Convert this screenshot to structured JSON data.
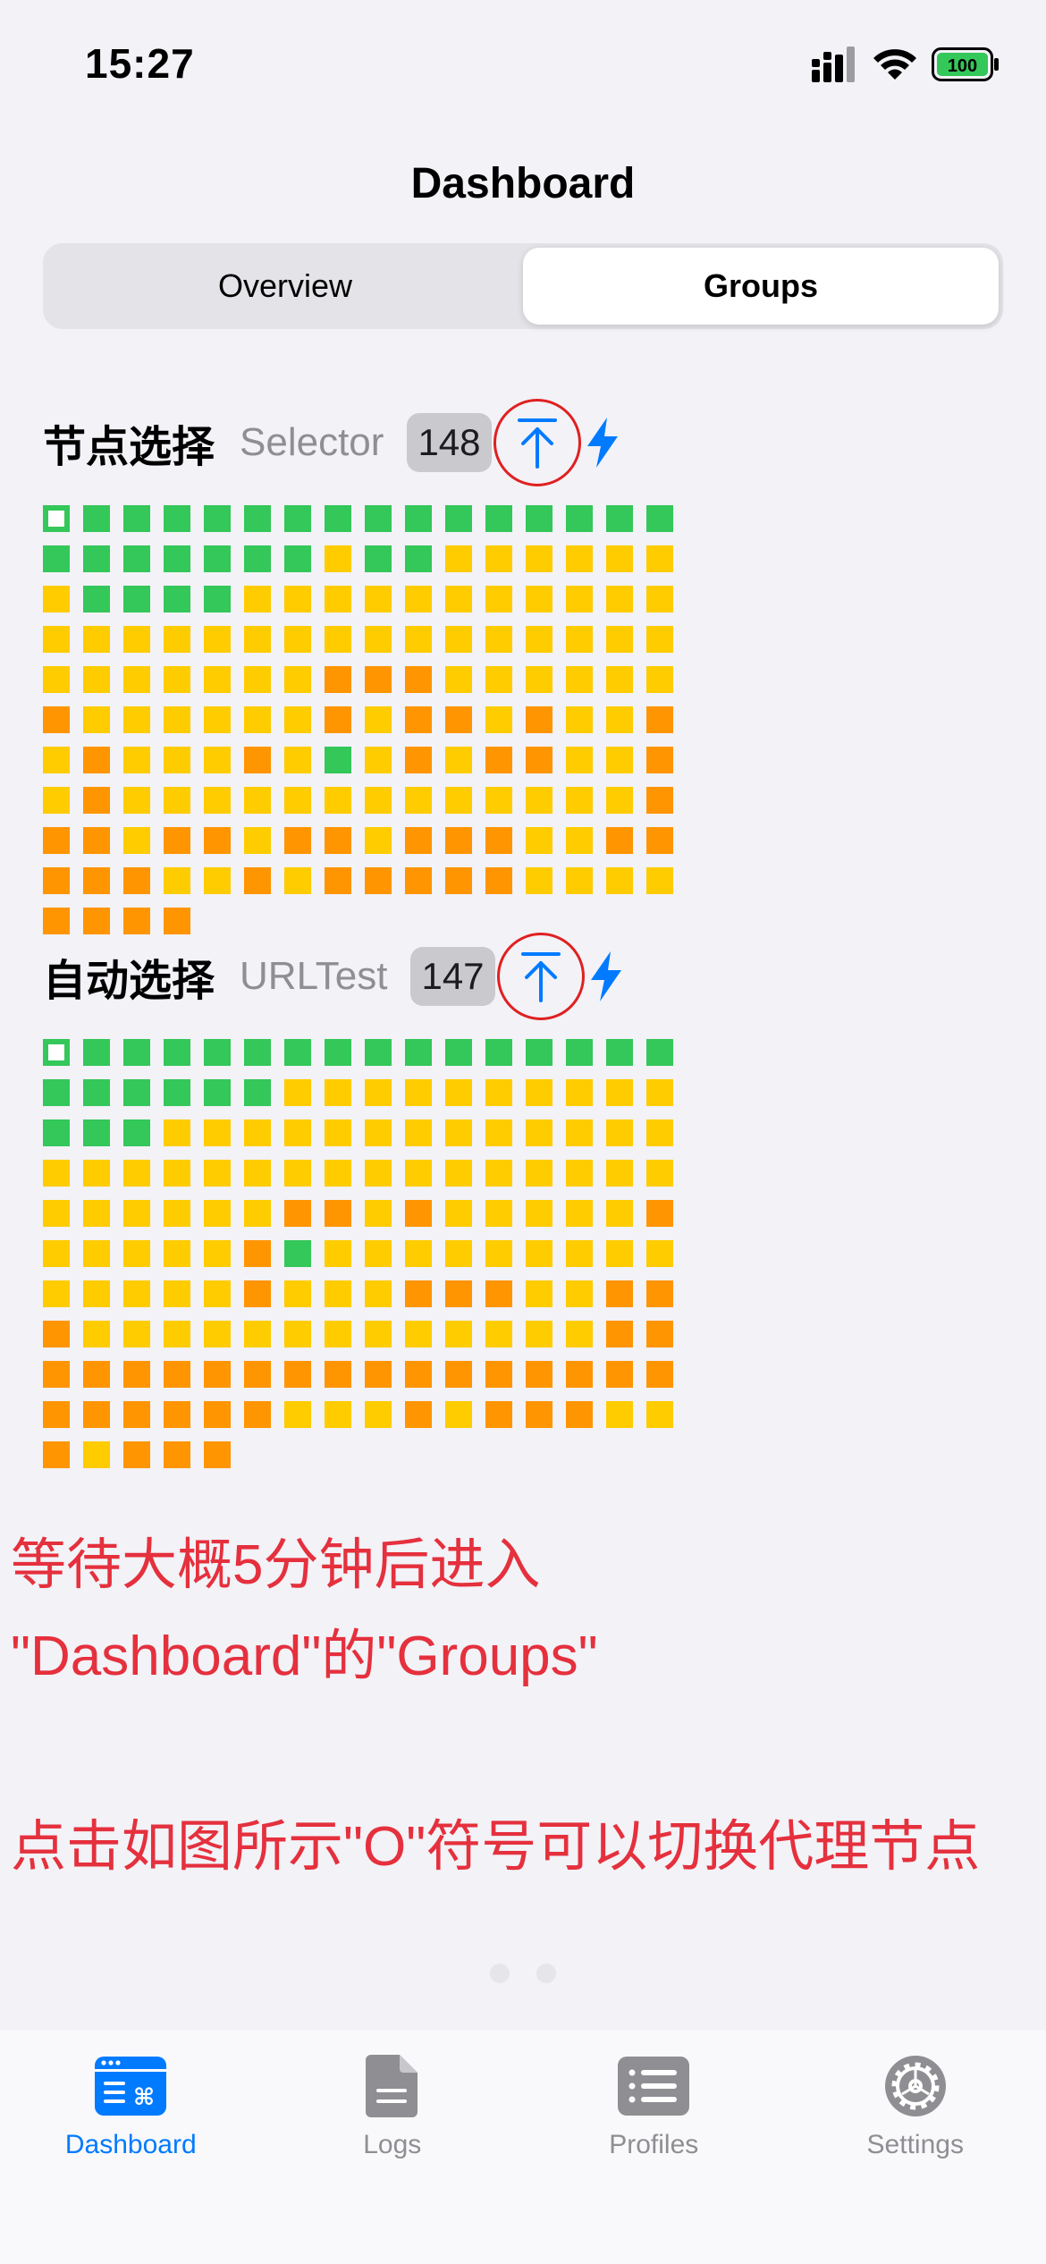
{
  "status_bar": {
    "time": "15:27",
    "battery": "100"
  },
  "nav": {
    "title": "Dashboard"
  },
  "segments": [
    {
      "label": "Overview",
      "active": false
    },
    {
      "label": "Groups",
      "active": true
    }
  ],
  "groups": [
    {
      "name": "节点选择",
      "type": "Selector",
      "count": "148",
      "nodes": "sggggggggggggggg gggggggyggyyyyyy yggggyyyyyyyyyyy yyyyyyyyyyyyyyyy yyyyyyyoooyyyyyy oyyyyyyoyooyoyyo yoyyyoygyoyooyyo yoyyyyyyyyyyyyyo ooyooyooyoooyyoo oooyyoyoooooyyyy oooo",
      "grid_codes": {
        "s": "selected",
        "g": "green",
        "y": "yellow",
        "o": "orange"
      }
    },
    {
      "name": "自动选择",
      "type": "URLTest",
      "count": "147",
      "nodes": "sggggggggggggggg ggggggyyyyyyyyyy gggyyyyyyyyyyyyy yyyyyyyyyyyyyyyy yyyyyyooyoyyyyyo yyyyyogyyyyyyyyy yyyyyoyyyoooyyoo oyyyyyyyyyyyyyoo oooooooooooooooo ooooooyyyoyoooyyoy ooo",
      "grid_codes": {
        "s": "selected",
        "g": "green",
        "y": "yellow",
        "o": "orange"
      }
    }
  ],
  "annotation": {
    "line1": "等待大概5分钟后进入",
    "line2": "\"Dashboard\"的\"Groups\"",
    "line3": "点击如图所示\"O\"符号可以切换代理节点"
  },
  "tabs": [
    {
      "label": "Dashboard",
      "icon": "dashboard-icon",
      "active": true
    },
    {
      "label": "Logs",
      "icon": "document-icon",
      "active": false
    },
    {
      "label": "Profiles",
      "icon": "list-icon",
      "active": false
    },
    {
      "label": "Settings",
      "icon": "gear-icon",
      "active": false
    }
  ],
  "colors": {
    "accent": "#007aff",
    "green": "#34c759",
    "yellow": "#ffcc00",
    "orange": "#ff9500",
    "annotation": "#e5303d"
  }
}
